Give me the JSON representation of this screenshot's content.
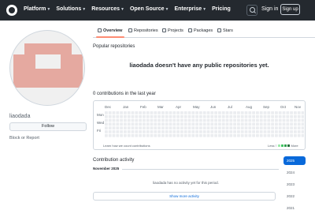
{
  "header": {
    "nav": [
      {
        "label": "Platform",
        "caret": true
      },
      {
        "label": "Solutions",
        "caret": true
      },
      {
        "label": "Resources",
        "caret": true
      },
      {
        "label": "Open Source",
        "caret": true
      },
      {
        "label": "Enterprise",
        "caret": true
      },
      {
        "label": "Pricing",
        "caret": false
      }
    ],
    "sign_in": "Sign in",
    "sign_up": "Sign up",
    "colors": {
      "bg": "#24292f"
    }
  },
  "profile": {
    "username": "liaodada",
    "follow": "Follow",
    "block": "Block or Report",
    "avatar_color": "#e5a9a0"
  },
  "tabs": [
    {
      "label": "Overview",
      "icon": "book-icon",
      "active": true
    },
    {
      "label": "Repositories",
      "icon": "repo-icon",
      "active": false
    },
    {
      "label": "Projects",
      "icon": "table-icon",
      "active": false
    },
    {
      "label": "Packages",
      "icon": "package-icon",
      "active": false
    },
    {
      "label": "Stars",
      "icon": "star-icon",
      "active": false
    }
  ],
  "popular": {
    "title": "Popular repositories",
    "empty": "liaodada doesn't have any public repositories yet."
  },
  "contributions": {
    "title": "0 contributions in the last year",
    "months": [
      "Dec",
      "Jan",
      "Feb",
      "Mar",
      "Apr",
      "May",
      "Jun",
      "Jul",
      "Aug",
      "Sep",
      "Oct",
      "Nov"
    ],
    "days": [
      "Mon",
      "Wed",
      "Fri"
    ],
    "learn": "Learn how we count contributions",
    "legend_less": "Less",
    "legend_more": "More",
    "legend_colors": [
      "#ebedf0",
      "#9be9a8",
      "#40c463",
      "#30a14e",
      "#216e39"
    ],
    "empty_color": "#ebedf0"
  },
  "activity": {
    "title": "Contribution activity",
    "month": "November 2025",
    "none": "liaodada has no activity yet for this period.",
    "show_more": "Show more activity"
  },
  "years": [
    "2025",
    "2024",
    "2023",
    "2022",
    "2021"
  ]
}
